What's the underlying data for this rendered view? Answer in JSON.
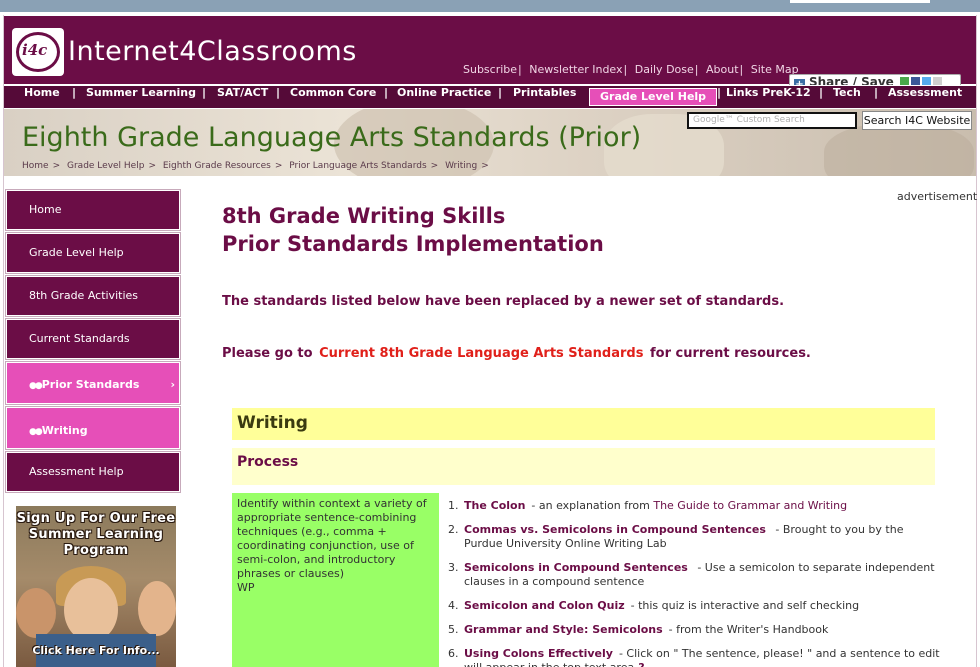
{
  "header": {
    "logo_text": "i4c",
    "site_name": "Internet4Classrooms",
    "top_links": [
      "Subscribe",
      "Newsletter Index",
      "Daily Dose",
      "About",
      "Site Map"
    ],
    "share_label": "Share / Save"
  },
  "nav": {
    "items": [
      "Home",
      "Summer Learning",
      "SAT/ACT",
      "Common Core",
      "Online Practice",
      "Printables",
      "Grade Level Help",
      "Links PreK-12",
      "Tech",
      "Assessment"
    ],
    "active": "Grade Level Help"
  },
  "banner": {
    "title": "Eighth Grade Language Arts Standards (Prior)",
    "search_placeholder": "Google™ Custom Search",
    "search_button": "Search I4C Website",
    "breadcrumbs": [
      "Home",
      "Grade Level Help",
      "Eighth Grade Resources",
      "Prior Language Arts Standards",
      "Writing"
    ]
  },
  "sidebar": {
    "items": [
      {
        "label": "Home"
      },
      {
        "label": "Grade Level Help"
      },
      {
        "label": "8th Grade Activities"
      },
      {
        "label": "Current Standards"
      },
      {
        "label": "Prior Standards"
      },
      {
        "label": "Writing"
      },
      {
        "label": "Assessment Help"
      }
    ],
    "ad": {
      "headline": "Sign Up For Our Free Summer Learning Program",
      "cta": "Click Here For Info..."
    }
  },
  "main": {
    "advertisement_label": "advertisement",
    "heading_line1": "8th Grade Writing Skills",
    "heading_line2": "Prior Standards Implementation",
    "notice": "The standards listed below have been replaced by a newer set of standards.",
    "goto_prefix": "Please go to",
    "goto_link": "Current 8th Grade Language Arts Standards",
    "goto_suffix": "for current resources.",
    "section_title": "Writing",
    "subsection_title": "Process",
    "standard_text": "Identify within context a variety of appropriate sentence-combining techniques (e.g., comma + coordinating conjunction, use of semi-colon, and introductory phrases or clauses)",
    "standard_code": "WP",
    "resources": [
      {
        "num": "1.",
        "title": "The Colon",
        "text": "- an explanation from",
        "ref": "The Guide to Grammar and Writing"
      },
      {
        "num": "2.",
        "title": "Commas vs. Semicolons in Compound Sentences",
        "text": " - Brought to you by the Purdue University Online Writing Lab",
        "ref": ""
      },
      {
        "num": "3.",
        "title": "Semicolons in Compound Sentences",
        "text": " - Use a semicolon to separate independent clauses in a compound sentence",
        "ref": ""
      },
      {
        "num": "4.",
        "title": "Semicolon and Colon Quiz",
        "text": "- this quiz is interactive and self checking",
        "ref": ""
      },
      {
        "num": "5.",
        "title": "Grammar and Style: Semicolons",
        "text": "- from the Writer's Handbook",
        "ref": ""
      },
      {
        "num": "6.",
        "title": "Using Colons Effectively",
        "text": "- Click on \" The sentence, please! \" and a sentence to edit will appear in the top text area",
        "ref": ""
      }
    ]
  },
  "colors": {
    "brand": "#6b0d46",
    "accent_pink": "#e64fb8",
    "standard_green": "#99ff66",
    "section_yellow": "#ffff99",
    "link_red": "#e0201a"
  }
}
